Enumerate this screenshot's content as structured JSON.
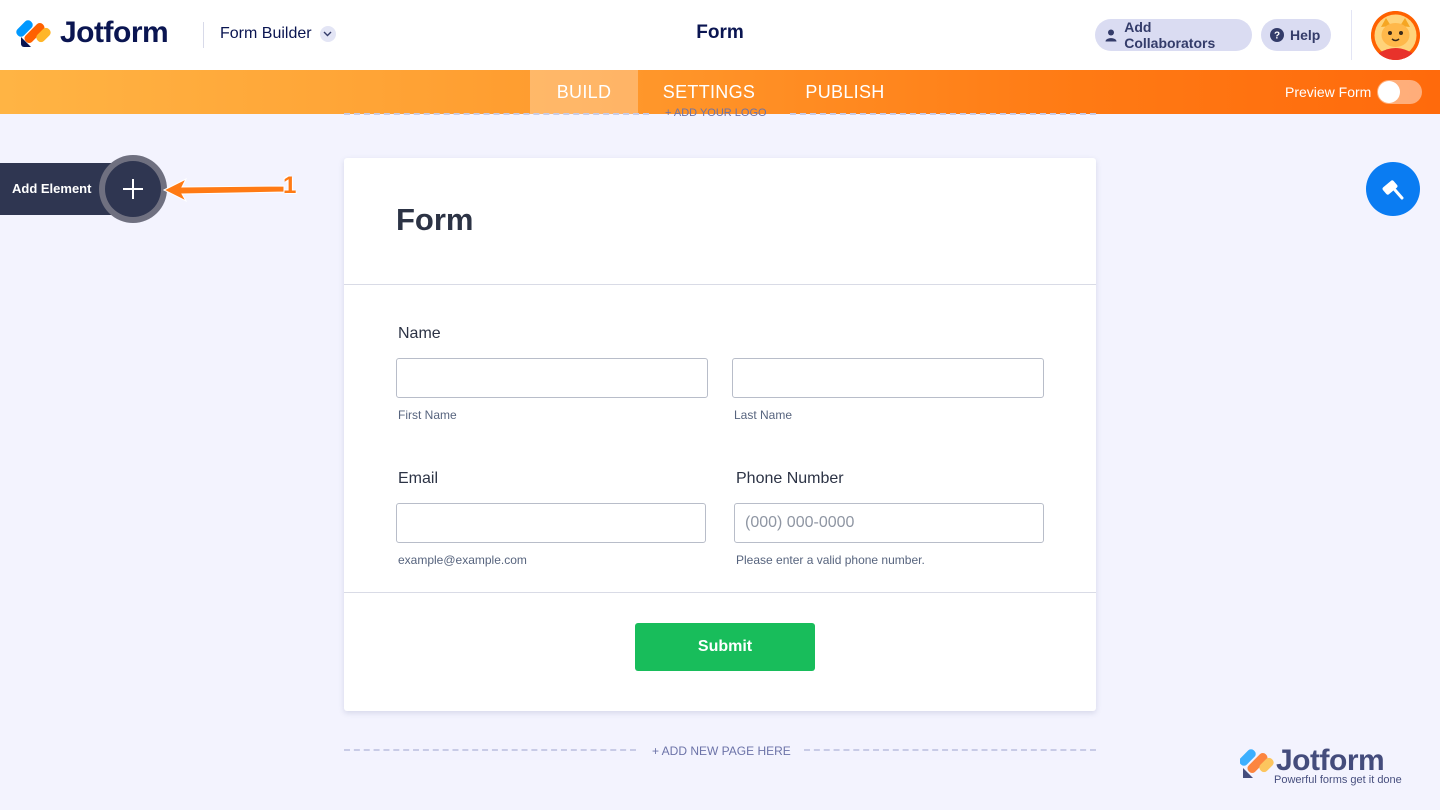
{
  "header": {
    "brand": "Jotform",
    "builder_switch": "Form Builder",
    "form_title": "Form",
    "add_collaborators": "Add Collaborators",
    "help": "Help"
  },
  "nav": {
    "tabs": [
      "BUILD",
      "SETTINGS",
      "PUBLISH"
    ],
    "active_tab": "BUILD",
    "preview_label": "Preview Form",
    "preview_on": false
  },
  "canvas": {
    "add_logo": "+ ADD YOUR LOGO",
    "add_element_label": "Add Element",
    "annotation_number": "1",
    "add_page": "+ ADD NEW PAGE HERE"
  },
  "form": {
    "title": "Form",
    "name_label": "Name",
    "first_name_sublabel": "First Name",
    "last_name_sublabel": "Last Name",
    "email_label": "Email",
    "email_sublabel": "example@example.com",
    "phone_label": "Phone Number",
    "phone_placeholder": "(000) 000-0000",
    "phone_sublabel": "Please enter a valid phone number.",
    "submit_label": "Submit"
  },
  "watermark": {
    "brand": "Jotform",
    "tagline": "Powerful forms get it done"
  },
  "colors": {
    "brand_navy": "#0a1551",
    "nav_orange": "#ff7a14",
    "submit_green": "#18bd5b",
    "designer_blue": "#0a7cf2"
  }
}
